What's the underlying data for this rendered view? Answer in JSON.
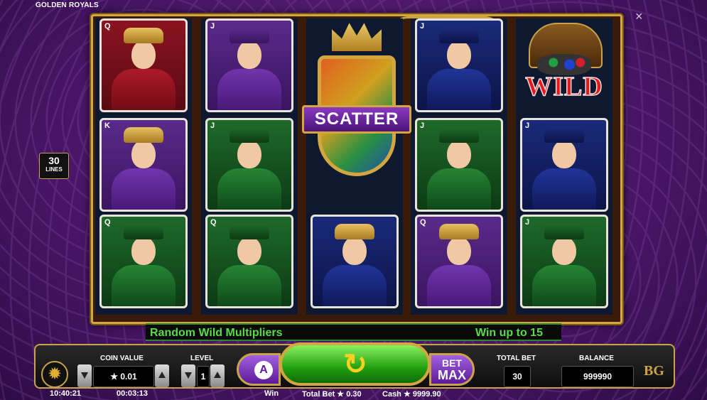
{
  "game_title": "GOLDEN ROYALS",
  "close_icon": "×",
  "lines": {
    "count": "30",
    "label": "LINES"
  },
  "reels": [
    [
      {
        "rank": "Q",
        "figure": "queen-red",
        "color": "red"
      },
      {
        "rank": "K",
        "figure": "king-purple",
        "color": "purple"
      },
      {
        "rank": "Q",
        "figure": "lady-green",
        "color": "green"
      }
    ],
    [
      {
        "rank": "J",
        "figure": "jester-purple",
        "color": "purple"
      },
      {
        "rank": "J",
        "figure": "knight-green",
        "color": "green"
      },
      {
        "rank": "Q",
        "figure": "lady-green",
        "color": "green"
      }
    ],
    [
      {
        "rank": "",
        "figure": "scatter",
        "color": "blue"
      },
      {
        "rank": "",
        "figure": "scatter",
        "color": "blue"
      },
      {
        "rank": "",
        "figure": "queen-blue",
        "color": "blue"
      }
    ],
    [
      {
        "rank": "J",
        "figure": "prince-blue",
        "color": "blue"
      },
      {
        "rank": "J",
        "figure": "knight-green",
        "color": "green"
      },
      {
        "rank": "Q",
        "figure": "queen-purple",
        "color": "purple"
      }
    ],
    [
      {
        "rank": "",
        "figure": "wild",
        "color": "gold"
      },
      {
        "rank": "J",
        "figure": "prince-blue",
        "color": "blue"
      },
      {
        "rank": "J",
        "figure": "knight-green",
        "color": "green"
      }
    ]
  ],
  "scatter_label": "SCATTER",
  "wild_label": "WILD",
  "ticker": {
    "left": "Random Wild Multipliers",
    "right": "Win up to 15"
  },
  "controls": {
    "coin_value_label": "COIN VALUE",
    "coin_value": "★ 0.01",
    "level_label": "LEVEL",
    "level": "1",
    "auto_label": "A",
    "spin_icon": "↻",
    "betmax_top": "BET",
    "betmax_bottom": "MAX",
    "total_bet_label": "TOTAL BET",
    "total_bet": "30",
    "balance_label": "BALANCE",
    "balance": "999990",
    "logo": "BG",
    "settings_icon": "✹"
  },
  "footer": {
    "clock": "10:40:21",
    "session_time": "00:03:13",
    "win": "Win",
    "total_bet": "Total Bet ★ 0.30",
    "cash": "Cash ★ 9999.90"
  }
}
